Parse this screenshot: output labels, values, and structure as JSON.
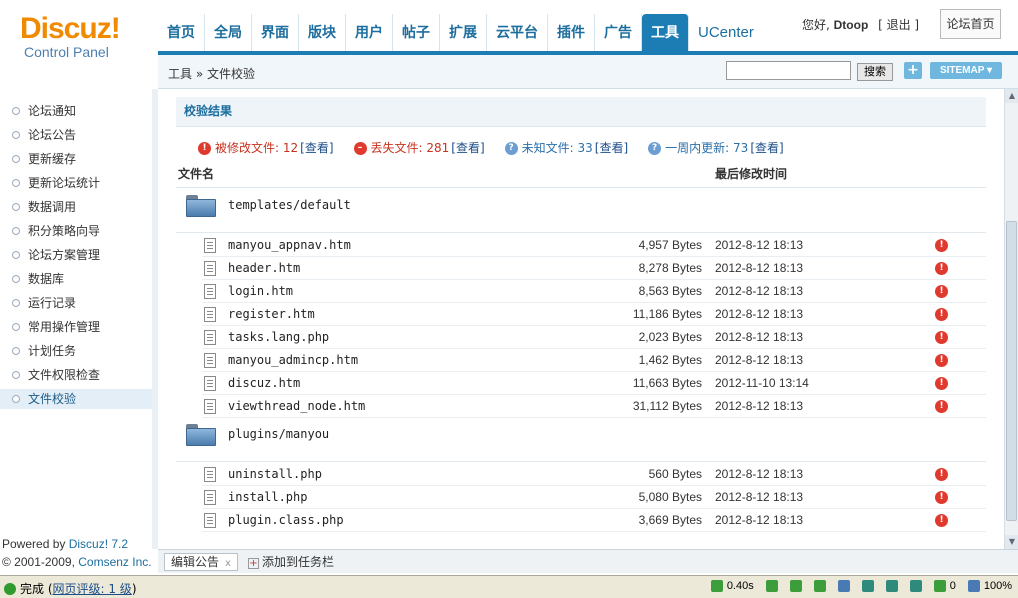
{
  "header": {
    "logo_main": "Discuz!",
    "logo_sub": "Control Panel",
    "nav": [
      "首页",
      "全局",
      "界面",
      "版块",
      "用户",
      "帖子",
      "扩展",
      "云平台",
      "插件",
      "广告",
      "工具",
      "UCenter"
    ],
    "active_nav": "工具",
    "greeting": "您好, ",
    "username": "Dtoop",
    "logout": "[ 退出 ]",
    "forum_home": "论坛首页"
  },
  "crumbbar": {
    "breadcrumb": "工具 » 文件校验",
    "search_value": "",
    "search_button": "搜索",
    "plus_button": "+",
    "sitemap_button": "SITEMAP ▾"
  },
  "sidebar": {
    "items": [
      "论坛通知",
      "论坛公告",
      "更新缓存",
      "更新论坛统计",
      "数据调用",
      "积分策略向导",
      "论坛方案管理",
      "数据库",
      "运行记录",
      "常用操作管理",
      "计划任务",
      "文件权限检查",
      "文件校验"
    ],
    "active_index": 12,
    "powered_prefix": "Powered by ",
    "powered_link": "Discuz! 7.2",
    "copyright_prefix": "© 2001-2009, ",
    "copyright_link": "Comsenz Inc."
  },
  "main": {
    "section_title": "校验结果",
    "summary": [
      {
        "icon": "!",
        "label": "被修改文件: 12",
        "link": "[查看]",
        "tone": "red"
      },
      {
        "icon": "–",
        "label": "丢失文件: 281",
        "link": "[查看]",
        "tone": "red"
      },
      {
        "icon": "?",
        "label": "未知文件: 33",
        "link": "[查看]",
        "tone": "blue"
      },
      {
        "icon": "?",
        "label": "一周内更新: 73",
        "link": "[查看]",
        "tone": "blue"
      }
    ],
    "col_file": "文件名",
    "col_time": "最后修改时间",
    "groups": [
      {
        "folder": "templates/default",
        "files": [
          {
            "name": "manyou_appnav.htm",
            "size": "4,957 Bytes",
            "time": "2012-8-12 18:13"
          },
          {
            "name": "header.htm",
            "size": "8,278 Bytes",
            "time": "2012-8-12 18:13"
          },
          {
            "name": "login.htm",
            "size": "8,563 Bytes",
            "time": "2012-8-12 18:13"
          },
          {
            "name": "register.htm",
            "size": "11,186 Bytes",
            "time": "2012-8-12 18:13"
          },
          {
            "name": "tasks.lang.php",
            "size": "2,023 Bytes",
            "time": "2012-8-12 18:13"
          },
          {
            "name": "manyou_admincp.htm",
            "size": "1,462 Bytes",
            "time": "2012-8-12 18:13"
          },
          {
            "name": "discuz.htm",
            "size": "11,663 Bytes",
            "time": "2012-11-10 13:14"
          },
          {
            "name": "viewthread_node.htm",
            "size": "31,112 Bytes",
            "time": "2012-8-12 18:13"
          }
        ]
      },
      {
        "folder": "plugins/manyou",
        "files": [
          {
            "name": "uninstall.php",
            "size": "560 Bytes",
            "time": "2012-8-12 18:13"
          },
          {
            "name": "install.php",
            "size": "5,080 Bytes",
            "time": "2012-8-12 18:13"
          },
          {
            "name": "plugin.class.php",
            "size": "3,669 Bytes",
            "time": "2012-8-12 18:13"
          }
        ]
      }
    ]
  },
  "taskbar": {
    "tab_label": "编辑公告",
    "tab_close": "x",
    "add_label": "添加到任务栏",
    "add_icon": "+"
  },
  "statusbar": {
    "status": "完成 (",
    "rating_link": "网页评级: 1 级",
    "status_close": ")",
    "load_time": "0.40s",
    "count": "0",
    "zoom": "100%"
  },
  "colors": {
    "accent": "#1b7db4",
    "logo": "#f08a00",
    "warning": "#e03a2f"
  }
}
